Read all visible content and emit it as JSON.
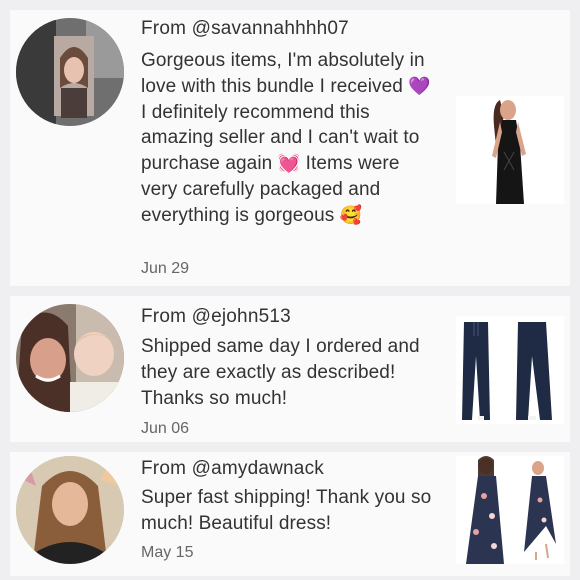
{
  "reviews": [
    {
      "from": "From @savannahhhh07",
      "message_parts": [
        "Gorgeous items, I'm absolutely in love with this bundle I received ",
        " I definitely recommend this amazing seller and I can't wait to purchase again ",
        " Items were very carefully packaged and everything is gorgeous "
      ],
      "emojis": [
        "💜",
        "💓",
        "🥰"
      ],
      "date": "Jun 29",
      "avatar_icon": "user-photo-icon",
      "product_icon": "black-jumpsuit-icon"
    },
    {
      "from": "From @ejohn513",
      "message": "Shipped same day I ordered and they are exactly as described! Thanks so much!",
      "date": "Jun 06",
      "avatar_icon": "user-photo-icon",
      "product_icon": "navy-pants-icon"
    },
    {
      "from": "From @amydawnack",
      "message": "Super fast shipping! Thank you so much! Beautiful dress!",
      "date": "May 15",
      "avatar_icon": "user-photo-icon",
      "product_icon": "floral-dress-icon"
    }
  ]
}
